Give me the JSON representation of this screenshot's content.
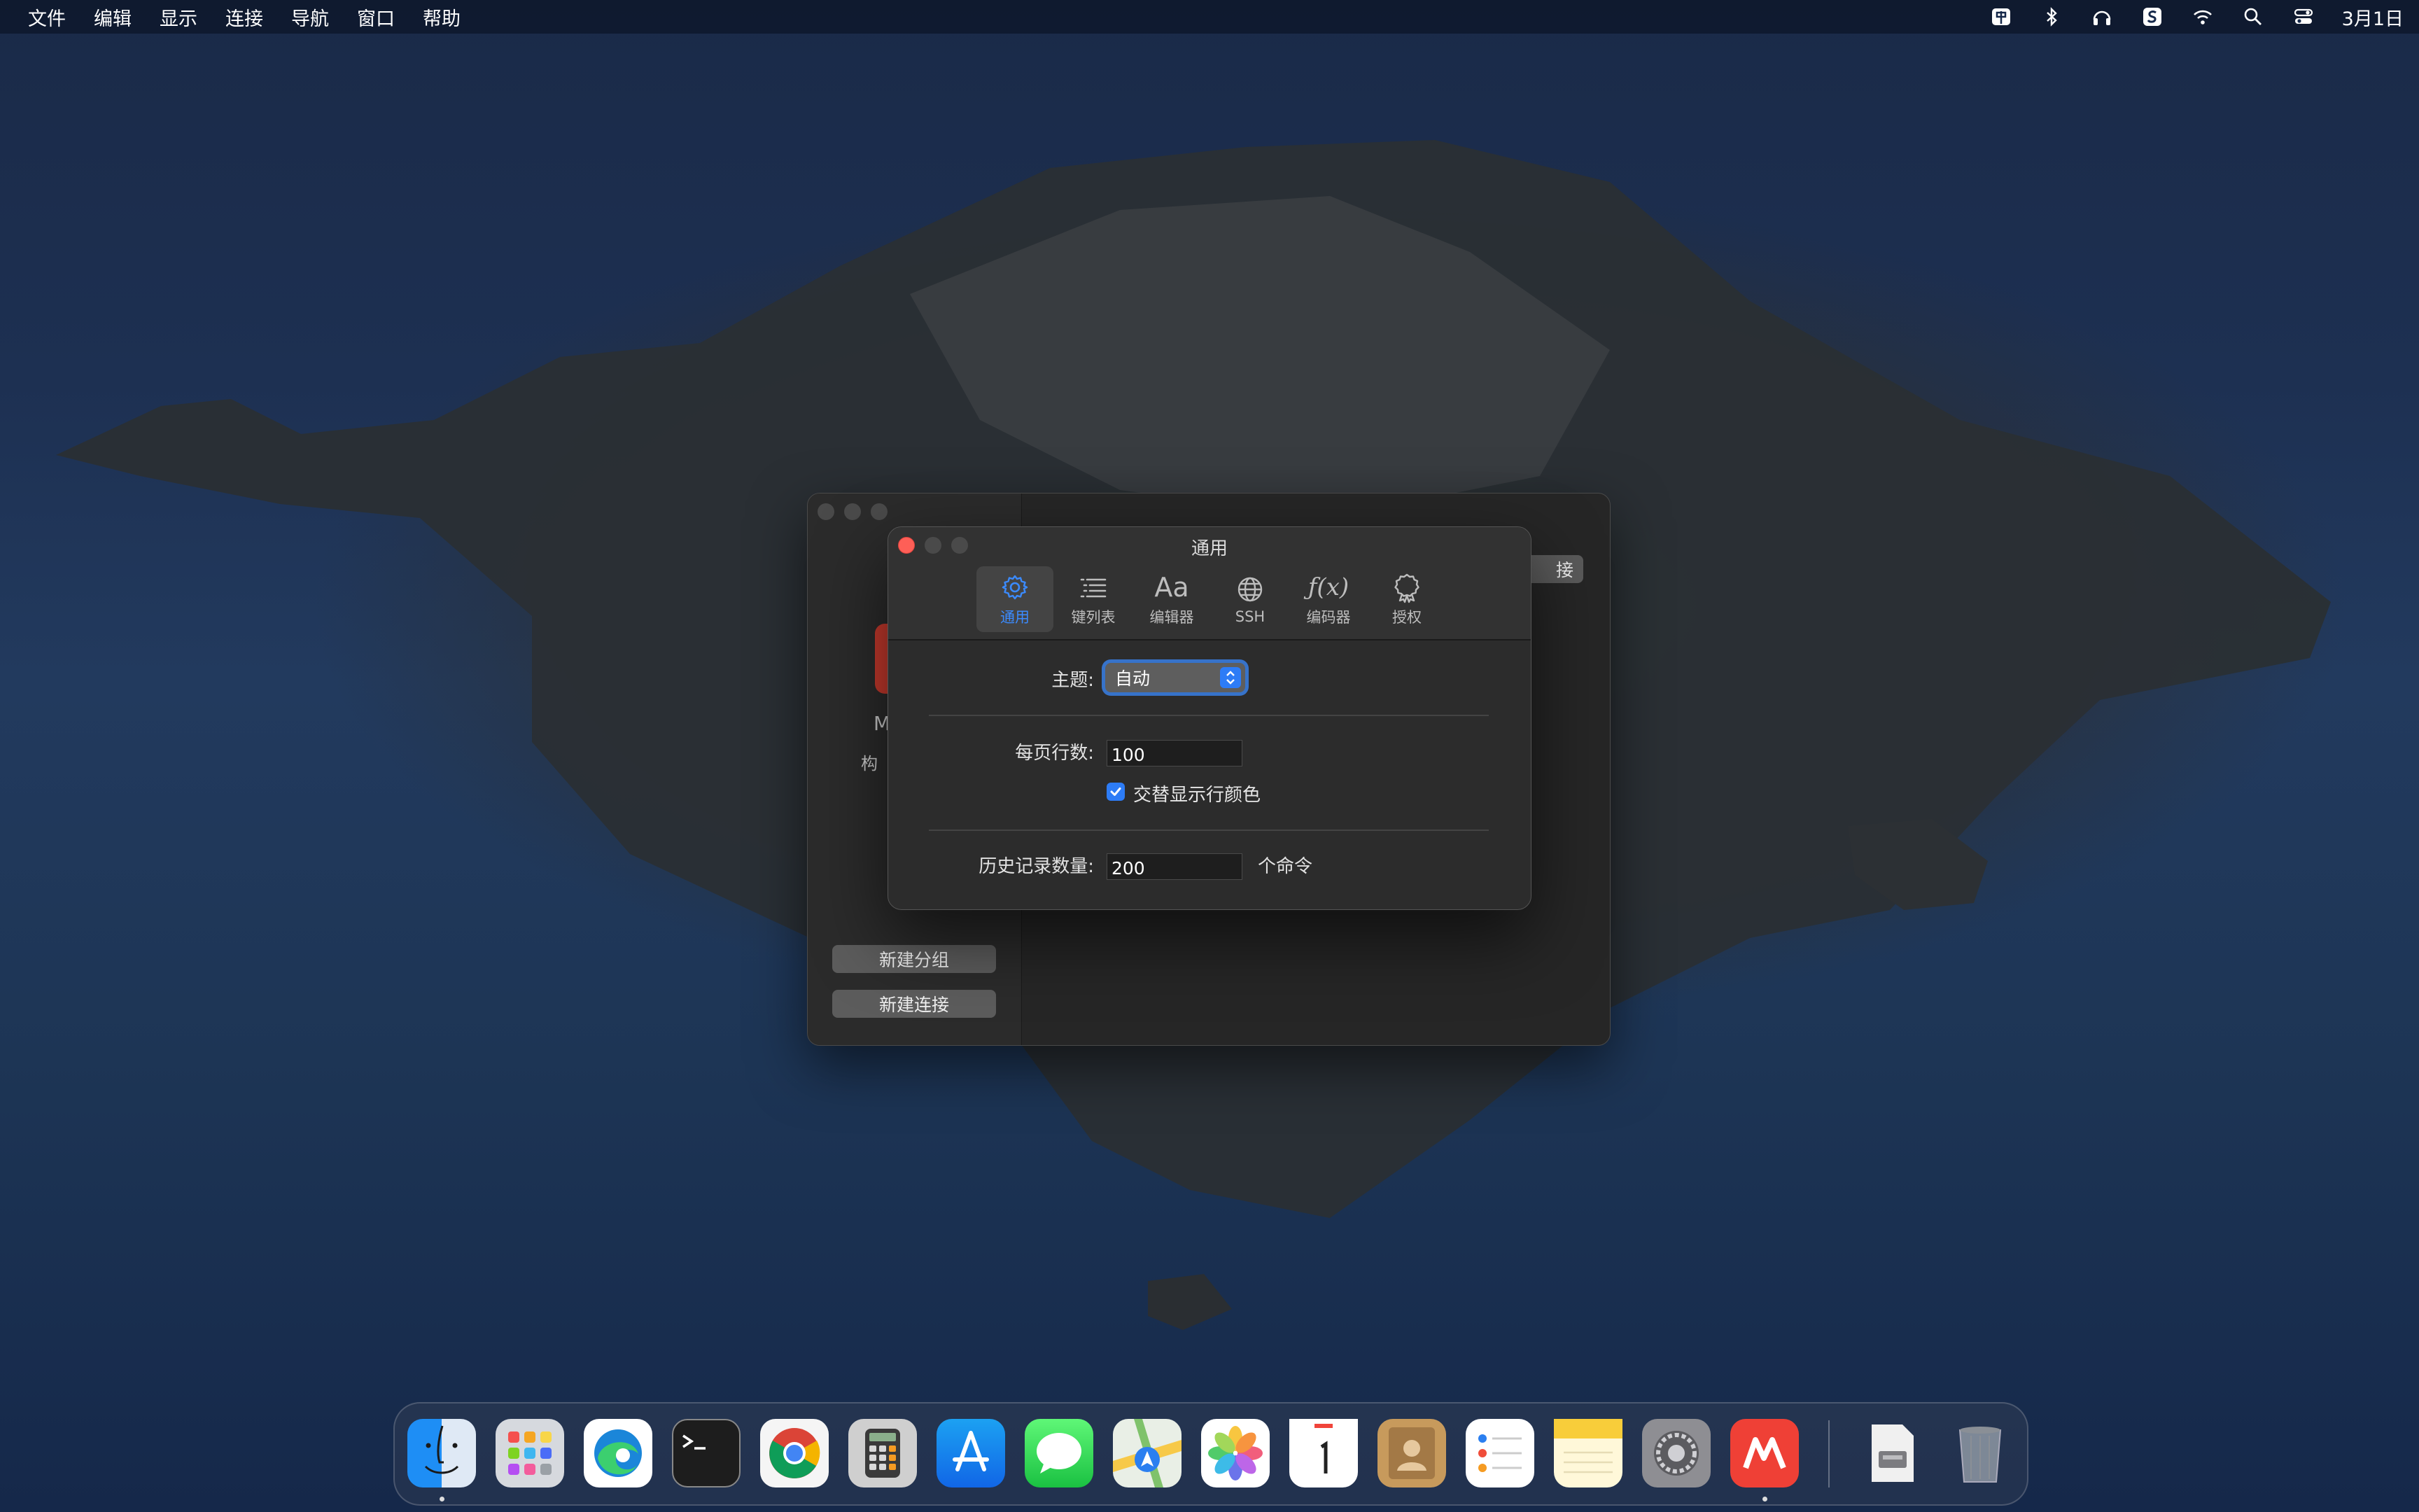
{
  "menubar": {
    "items": [
      "文件",
      "编辑",
      "显示",
      "连接",
      "导航",
      "窗口",
      "帮助"
    ],
    "clock": "3月1日"
  },
  "background_window": {
    "top_button": "接",
    "peek_letter": "M",
    "peek_text": "构",
    "new_group_button": "新建分组",
    "new_connection_button": "新建连接"
  },
  "prefs": {
    "title": "通用",
    "tabs": [
      {
        "label": "通用",
        "icon": "gear-icon",
        "active": true
      },
      {
        "label": "键列表",
        "icon": "list-icon",
        "active": false
      },
      {
        "label": "编辑器",
        "icon": "font-icon",
        "active": false
      },
      {
        "label": "SSH",
        "icon": "globe-icon",
        "active": false
      },
      {
        "label": "编码器",
        "icon": "function-icon",
        "active": false
      },
      {
        "label": "授权",
        "icon": "award-icon",
        "active": false
      }
    ],
    "tab_glyphs": {
      "editor": "Aa",
      "encoder": "ƒ(x)"
    },
    "theme_label": "主题:",
    "theme_value": "自动",
    "rows_per_page_label": "每页行数:",
    "rows_per_page_value": "100",
    "alternate_colors_label": "交替显示行颜色",
    "alternate_colors_checked": true,
    "history_label": "历史记录数量:",
    "history_value": "200",
    "history_unit": "个命令"
  },
  "colors": {
    "accent": "#2d7cf6",
    "close": "#fe5f57"
  }
}
